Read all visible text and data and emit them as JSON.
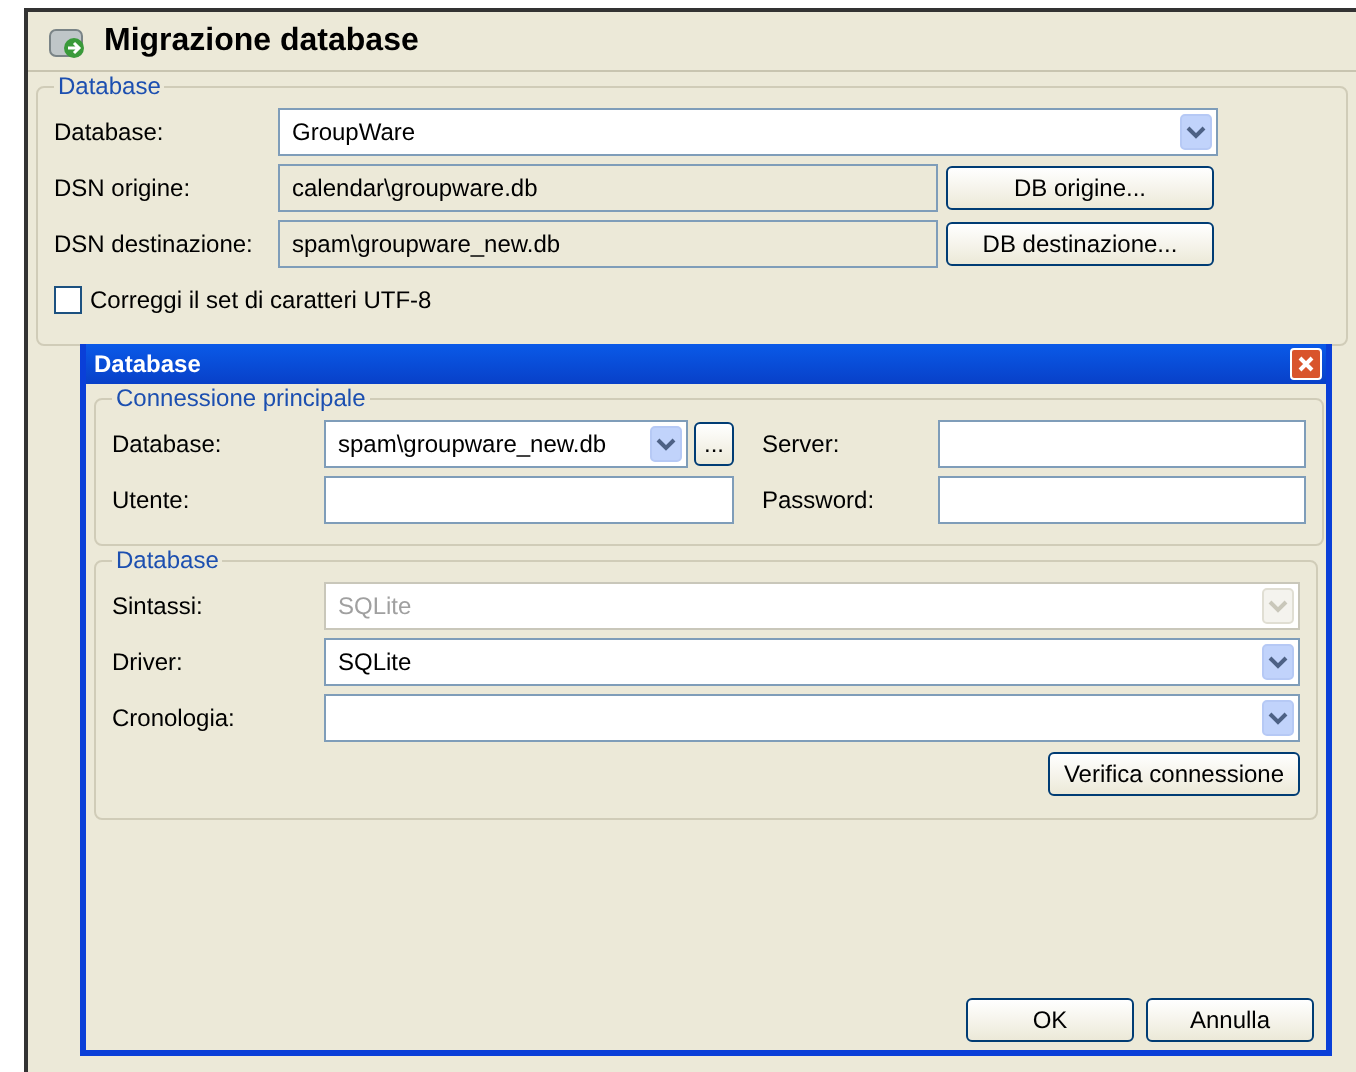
{
  "window": {
    "title": "Migrazione database"
  },
  "database_group": {
    "legend": "Database",
    "database": {
      "label": "Database:",
      "value": "GroupWare"
    },
    "dsn_rows": [
      {
        "label": "DSN origine:",
        "value": "calendar\\groupware.db",
        "button": "DB origine..."
      },
      {
        "label": "DSN destinazione:",
        "value": "spam\\groupware_new.db",
        "button": "DB destinazione..."
      }
    ],
    "utf8_checkbox": {
      "label": "Correggi il set di caratteri UTF-8",
      "checked": false
    }
  },
  "dialog": {
    "title": "Database",
    "connection": {
      "legend": "Connessione principale",
      "database": {
        "label": "Database:",
        "value": "spam\\groupware_new.db",
        "browse": "..."
      },
      "user": {
        "label": "Utente:"
      },
      "server": {
        "label": "Server:"
      },
      "password": {
        "label": "Password:"
      }
    },
    "database_group": {
      "legend": "Database",
      "rows": [
        {
          "label": "Sintassi:",
          "value": "SQLite",
          "disabled": true
        },
        {
          "label": "Driver:",
          "value": "SQLite",
          "disabled": false
        },
        {
          "label": "Cronologia:",
          "disabled": false
        }
      ],
      "test_button": "Verifica connessione"
    },
    "buttons": [
      "OK",
      "Annulla"
    ]
  }
}
